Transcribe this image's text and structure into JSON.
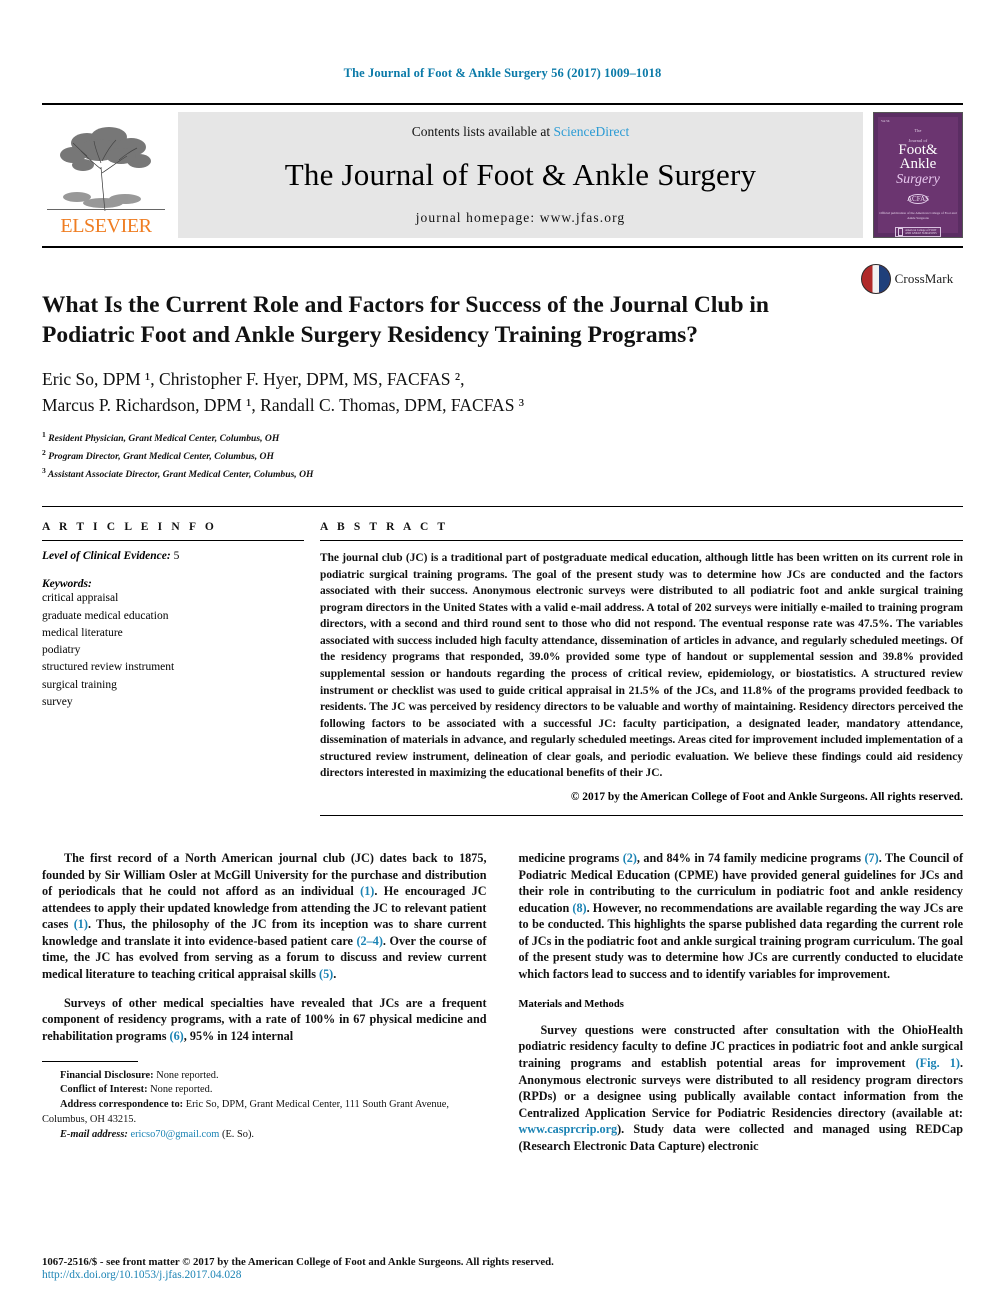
{
  "running_head": "The Journal of Foot & Ankle Surgery 56 (2017) 1009–1018",
  "masthead": {
    "publisher_name": "ELSEVIER",
    "contents_prefix": "Contents lists available at",
    "contents_link": "ScienceDirect",
    "journal_title": "The Journal of Foot & Ankle Surgery",
    "homepage": "journal homepage: www.jfas.org",
    "cover": {
      "issue_label": "Vol 56",
      "line1": "The",
      "line2": "Journal of",
      "word_foot": "Foot&",
      "word_ankle": "Ankle",
      "word_surgery": "Surgery",
      "seal": "ACFAS",
      "caption": "Official publication of\nthe American College of Foot and Ankle Surgeons",
      "badge_text": "American College of\nFOOT AND ANKLE SURGEONS"
    }
  },
  "article": {
    "title": "What Is the Current Role and Factors for Success of the Journal Club in Podiatric Foot and Ankle Surgery Residency Training Programs?",
    "crossmark_label": "CrossMark",
    "authors_line_1": "Eric So, DPM ¹, Christopher F. Hyer, DPM, MS, FACFAS ²,",
    "authors_line_2": "Marcus P. Richardson, DPM ¹, Randall C. Thomas, DPM, FACFAS ³",
    "affiliations": [
      "Resident Physician, Grant Medical Center, Columbus, OH",
      "Program Director, Grant Medical Center, Columbus, OH",
      "Assistant Associate Director, Grant Medical Center, Columbus, OH"
    ]
  },
  "article_info": {
    "heading": "A R T I C L E   I N F O",
    "level_of_evidence_label": "Level of Clinical Evidence:",
    "level_of_evidence_value": "5",
    "keywords_label": "Keywords:",
    "keywords": [
      "critical appraisal",
      "graduate medical education",
      "medical literature",
      "podiatry",
      "structured review instrument",
      "surgical training",
      "survey"
    ]
  },
  "abstract": {
    "heading": "A B S T R A C T",
    "text": "The journal club (JC) is a traditional part of postgraduate medical education, although little has been written on its current role in podiatric surgical training programs. The goal of the present study was to determine how JCs are conducted and the factors associated with their success. Anonymous electronic surveys were distributed to all podiatric foot and ankle surgical training program directors in the United States with a valid e-mail address. A total of 202 surveys were initially e-mailed to training program directors, with a second and third round sent to those who did not respond. The eventual response rate was 47.5%. The variables associated with success included high faculty attendance, dissemination of articles in advance, and regularly scheduled meetings. Of the residency programs that responded, 39.0% provided some type of handout or supplemental session and 39.8% provided supplemental session or handouts regarding the process of critical review, epidemiology, or biostatistics. A structured review instrument or checklist was used to guide critical appraisal in 21.5% of the JCs, and 11.8% of the programs provided feedback to residents. The JC was perceived by residency directors to be valuable and worthy of maintaining. Residency directors perceived the following factors to be associated with a successful JC: faculty participation, a designated leader, mandatory attendance, dissemination of materials in advance, and regularly scheduled meetings. Areas cited for improvement included implementation of a structured review instrument, delineation of clear goals, and periodic evaluation. We believe these findings could aid residency directors interested in maximizing the educational benefits of their JC.",
    "copyright": "© 2017 by the American College of Foot and Ankle Surgeons. All rights reserved."
  },
  "body": {
    "left_para_1_a": "The first record of a North American journal club (JC) dates back to 1875, founded by Sir William Osler at McGill University for the purchase and distribution of periodicals that he could not afford as an individual ",
    "left_para_1_ref1": "(1)",
    "left_para_1_b": ". He encouraged JC attendees to apply their updated knowledge from attending the JC to relevant patient cases ",
    "left_para_1_ref2": "(1)",
    "left_para_1_c": ". Thus, the philosophy of the JC from its inception was to share current knowledge and translate it into evidence-based patient care ",
    "left_para_1_ref3": "(2–4)",
    "left_para_1_d": ". Over the course of time, the JC has evolved from serving as a forum to discuss and review current medical literature to teaching critical appraisal skills ",
    "left_para_1_ref4": "(5)",
    "left_para_1_e": ".",
    "left_para_2_a": "Surveys of other medical specialties have revealed that JCs are a frequent component of residency programs, with a rate of 100% in 67 physical medicine and rehabilitation programs ",
    "left_para_2_ref1": "(6)",
    "left_para_2_b": ", 95% in 124 internal",
    "right_para_1_a": "medicine programs ",
    "right_para_1_ref1": "(2)",
    "right_para_1_b": ", and 84% in 74 family medicine programs ",
    "right_para_1_ref2": "(7)",
    "right_para_1_c": ". The Council of Podiatric Medical Education (CPME) have provided general guidelines for JCs and their role in contributing to the curriculum in podiatric foot and ankle residency education ",
    "right_para_1_ref3": "(8)",
    "right_para_1_d": ". However, no recommendations are available regarding the way JCs are to be conducted. This highlights the sparse published data regarding the current role of JCs in the podiatric foot and ankle surgical training program curriculum. The goal of the present study was to determine how JCs are currently conducted to elucidate which factors lead to success and to identify variables for improvement.",
    "methods_heading": "Materials and Methods",
    "methods_para_a": "Survey questions were constructed after consultation with the OhioHealth podiatric residency faculty to define JC practices in podiatric foot and ankle surgical training programs and establish potential areas for improvement ",
    "methods_fig_ref": "(Fig. 1)",
    "methods_para_b": ". Anonymous electronic surveys were distributed to all residency program directors (RPDs) or a designee using publically available contact information from the Centralized Application Service for Podiatric Residencies directory (available at: ",
    "methods_url": "www.casprcrip.org",
    "methods_para_c": "). Study data were collected and managed using REDCap (Research Electronic Data Capture) electronic"
  },
  "footnotes": {
    "financial_label": "Financial Disclosure:",
    "financial_value": "None reported.",
    "conflict_label": "Conflict of Interest:",
    "conflict_value": "None reported.",
    "address_label": "Address correspondence to:",
    "address_value": "Eric So, DPM, Grant Medical Center, 111 South Grant Avenue, Columbus, OH 43215.",
    "email_label": "E-mail address:",
    "email_value": "ericso70@gmail.com",
    "email_suffix": "(E. So)."
  },
  "page_footer": {
    "front_matter": "1067-2516/$ - see front matter © 2017 by the American College of Foot and Ankle Surgeons. All rights reserved.",
    "doi": "http://dx.doi.org/10.1053/j.jfas.2017.04.028"
  },
  "colors": {
    "link_blue": "#1b83b4",
    "header_blue": "#0b7aa8",
    "elsevier_orange": "#ef7d22",
    "masthead_grey": "#e6e6e6",
    "cover_purple": "#5b2d63"
  }
}
